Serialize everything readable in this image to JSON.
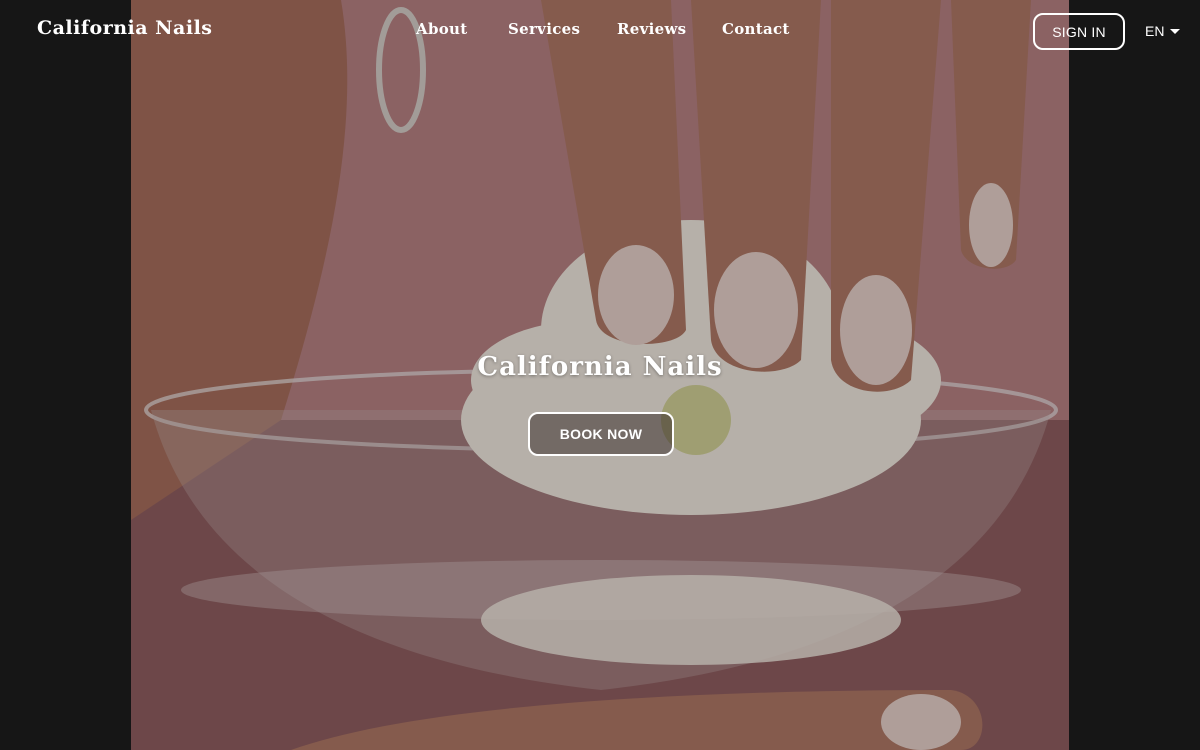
{
  "header": {
    "brand": "California Nails",
    "nav": [
      "About",
      "Services",
      "Reviews",
      "Contact"
    ],
    "sign_in_label": "SIGN IN",
    "language": "EN"
  },
  "hero": {
    "title": "California Nails",
    "cta_label": "BOOK NOW",
    "image_description_icon": "hero-photo-nails-flower"
  },
  "colors": {
    "page_background": "#161616",
    "text": "#ffffff"
  }
}
